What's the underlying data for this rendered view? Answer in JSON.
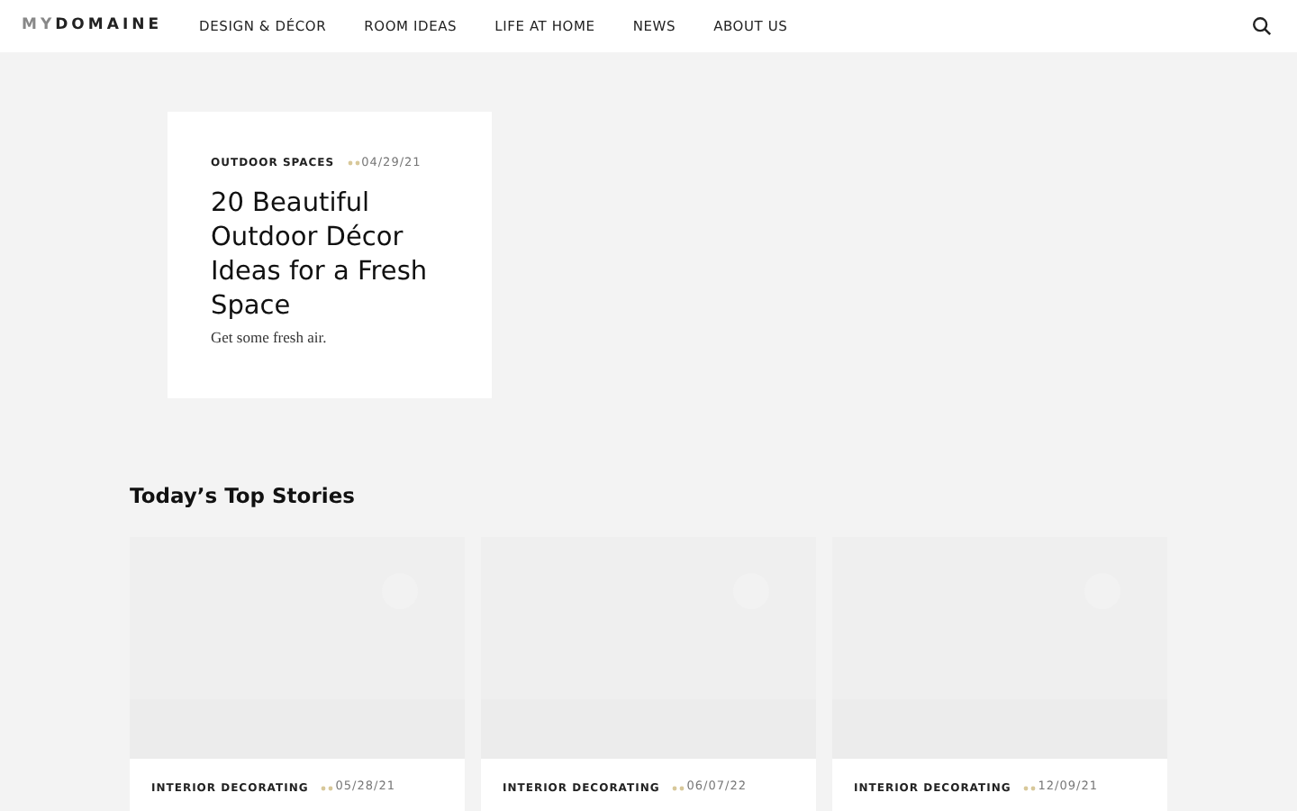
{
  "header": {
    "logo_prefix": "MY",
    "logo_main": "DOMAINE",
    "nav": [
      {
        "label": "DESIGN & DÉCOR"
      },
      {
        "label": "ROOM IDEAS"
      },
      {
        "label": "LIFE AT HOME"
      },
      {
        "label": "NEWS"
      },
      {
        "label": "ABOUT US"
      }
    ]
  },
  "feature": {
    "category": "OUTDOOR SPACES",
    "date": "04/29/21",
    "title": "20 Beautiful Outdoor Décor Ideas for a Fresh Space",
    "dek": "Get some fresh air."
  },
  "section_title": "Today’s Top Stories",
  "stories": [
    {
      "category": "INTERIOR DECORATING",
      "date": "05/28/21"
    },
    {
      "category": "INTERIOR DECORATING",
      "date": "06/07/22"
    },
    {
      "category": "INTERIOR DECORATING",
      "date": "12/09/21"
    }
  ]
}
